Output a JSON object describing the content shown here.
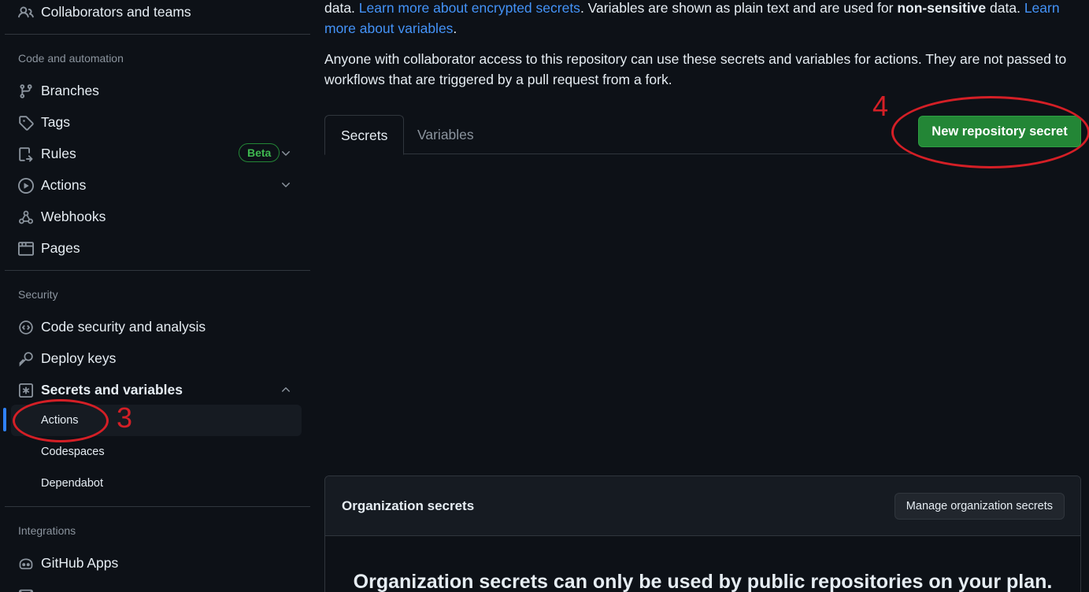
{
  "sidebar": {
    "top_item": {
      "label": "Collaborators and teams",
      "icon": "people-icon"
    },
    "section_code": {
      "heading": "Code and automation",
      "items": [
        {
          "label": "Branches",
          "icon": "git-branch-icon"
        },
        {
          "label": "Tags",
          "icon": "tag-icon"
        },
        {
          "label": "Rules",
          "icon": "rules-icon",
          "badge": "Beta"
        },
        {
          "label": "Actions",
          "icon": "play-icon"
        },
        {
          "label": "Webhooks",
          "icon": "webhook-icon"
        },
        {
          "label": "Pages",
          "icon": "browser-icon"
        }
      ]
    },
    "section_security": {
      "heading": "Security",
      "items": [
        {
          "label": "Code security and analysis",
          "icon": "codescan-icon"
        },
        {
          "label": "Deploy keys",
          "icon": "key-icon"
        },
        {
          "label": "Secrets and variables",
          "icon": "asterisk-icon"
        }
      ],
      "sub_items": [
        "Actions",
        "Codespaces",
        "Dependabot"
      ]
    },
    "section_integrations": {
      "heading": "Integrations",
      "items": [
        {
          "label": "GitHub Apps",
          "icon": "apps-icon"
        }
      ]
    }
  },
  "main": {
    "intro": {
      "p1_start": "data. ",
      "p1_link1": "Learn more about encrypted secrets",
      "p1_mid": ". Variables are shown as plain text and are used for ",
      "p1_bold": "non-sensitive",
      "p1_mid2": " data. ",
      "p1_link2": "Learn more about variables",
      "p1_end": ".",
      "p2": "Anyone with collaborator access to this repository can use these secrets and variables for actions. They are not passed to workflows that are triggered by a pull request from a fork."
    },
    "tabs": [
      "Secrets",
      "Variables"
    ],
    "new_secret_button": "New repository secret",
    "org": {
      "title": "Organization secrets",
      "manage_button": "Manage organization secrets",
      "message": "Organization secrets can only be used by public repositories on your plan."
    }
  },
  "annotations": {
    "step3": "3",
    "step4": "4",
    "color": "#d41f26"
  }
}
